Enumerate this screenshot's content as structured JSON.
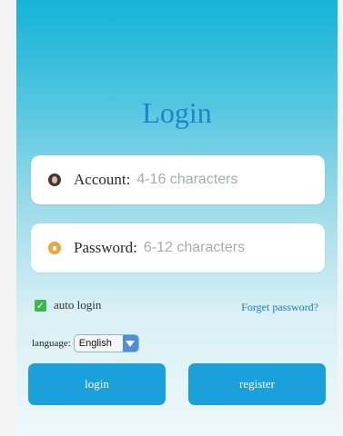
{
  "title": "Login",
  "account": {
    "label": "Account:",
    "placeholder": "4-16 characters",
    "icon": "avatar-icon"
  },
  "password": {
    "label": "Password:",
    "placeholder": "6-12 characters",
    "icon": "lock-icon"
  },
  "auto_login": {
    "label": "auto login",
    "checked": true
  },
  "forget_link": "Forget password?",
  "language": {
    "label": "language:",
    "selected": "English"
  },
  "buttons": {
    "login": "login",
    "register": "register"
  },
  "colors": {
    "brand_top": "#14b3d6",
    "title": "#1e84c8",
    "button": "#1aa0db",
    "checkbox": "#3cb84a",
    "link": "#1b79c7"
  }
}
